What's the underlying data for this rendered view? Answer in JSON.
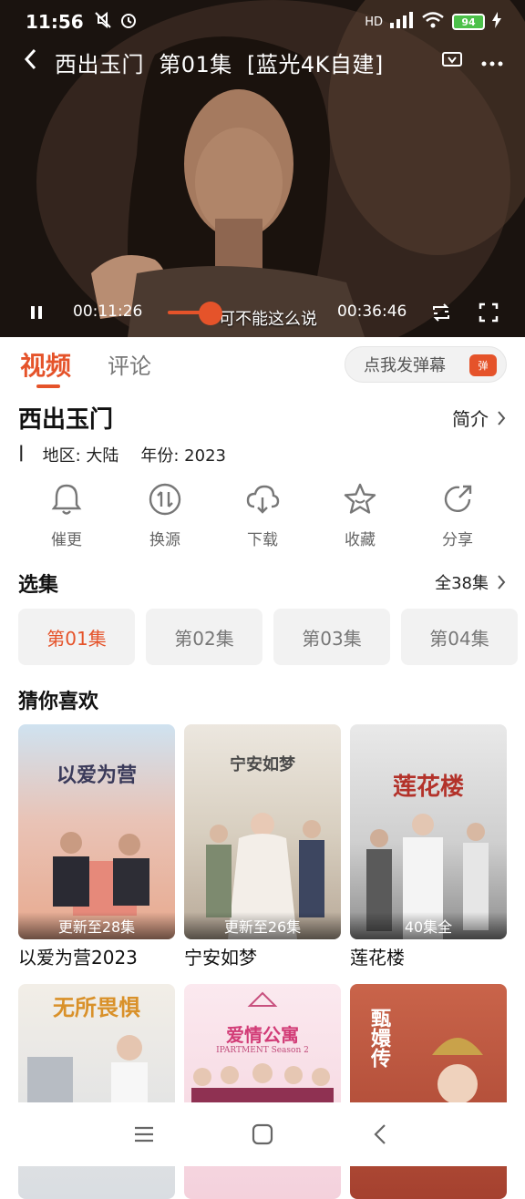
{
  "status_bar": {
    "time": "11:56",
    "network": "HD",
    "battery": "94"
  },
  "player": {
    "title": "西出玉门  第01集  [蓝光4K自建]",
    "current_time": "00:11:26",
    "duration": "00:36:46",
    "progress": 0.31,
    "subtitle": "可不能这么说"
  },
  "tabs": [
    {
      "label": "视频",
      "active": true
    },
    {
      "label": "评论",
      "active": false
    }
  ],
  "danmu": {
    "placeholder": "点我发弹幕",
    "badge": "弹"
  },
  "show": {
    "title": "西出玉门",
    "intro_label": "简介",
    "region_label": "地区: 大陆",
    "year_label": "年份: 2023"
  },
  "actions": [
    {
      "label": "催更",
      "icon": "bell-icon"
    },
    {
      "label": "换源",
      "icon": "switch-source-icon"
    },
    {
      "label": "下载",
      "icon": "cloud-download-icon"
    },
    {
      "label": "收藏",
      "icon": "star-icon"
    },
    {
      "label": "分享",
      "icon": "share-icon"
    }
  ],
  "episodes": {
    "section_title": "选集",
    "all_label": "全38集",
    "items": [
      "第01集",
      "第02集",
      "第03集",
      "第04集"
    ],
    "active_index": 0
  },
  "recommend": {
    "section_title": "猜你喜欢",
    "items": [
      {
        "name": "以爱为营2023",
        "badge": "更新至28集"
      },
      {
        "name": "宁安如梦",
        "badge": "更新至26集"
      },
      {
        "name": "莲花楼",
        "badge": "40集全"
      },
      {
        "name": "",
        "badge": ""
      },
      {
        "name": "",
        "badge": ""
      },
      {
        "name": "",
        "badge": ""
      }
    ],
    "poster_titles": [
      "以爱为营",
      "宁安如梦",
      "莲花楼",
      "无所畏惧",
      "爱情公寓",
      "甄嬛传"
    ],
    "poster_subtitles": [
      "",
      "",
      "",
      "",
      "IPARTMENT Season 2",
      ""
    ]
  },
  "colors": {
    "accent": "#e5532a",
    "chip_bg": "#f2f2f2"
  }
}
